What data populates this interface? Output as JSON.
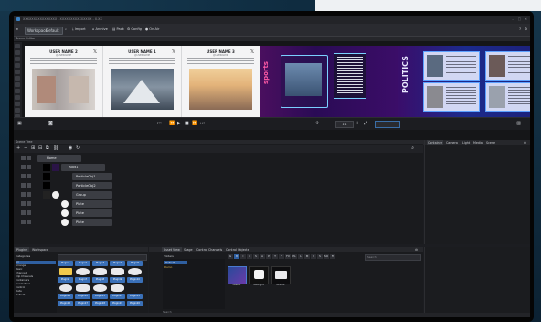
{
  "window": {
    "title": "XXXXXXXXXXXXXXXX - XXXXXXXXXXXXXXX - X.XX"
  },
  "toolbar": {
    "workspace_label": "Workspace",
    "workspace_value": "Default",
    "import_label": "Import",
    "archive_label": "Archive",
    "pack_label": "Pack",
    "config_label": "Config",
    "onair_label": "On Air"
  },
  "scene_editor": {
    "header": "Scene Editor",
    "zoom": "1:1"
  },
  "canvas": {
    "cards": [
      {
        "username": "USER NAME 2",
        "handle": "@USERNAME"
      },
      {
        "username": "USER NAME 1",
        "handle": "@USERNAME"
      },
      {
        "username": "USER NAME 3",
        "handle": "@USERNAME"
      }
    ],
    "sports_label": "sports",
    "politics_label": "POLITICS"
  },
  "scene_tree": {
    "header": "Scene Tree",
    "nodes": [
      {
        "label": "Home",
        "depth": 0
      },
      {
        "label": "Root1",
        "depth": 1
      },
      {
        "label": "ParticleObj1",
        "depth": 2
      },
      {
        "label": "ParticleObj2",
        "depth": 2
      },
      {
        "label": "Group",
        "depth": 2
      },
      {
        "label": "Plate",
        "depth": 2
      },
      {
        "label": "Plate",
        "depth": 2
      },
      {
        "label": "Plate",
        "depth": 2
      }
    ]
  },
  "right_panel": {
    "tabs": [
      "Container",
      "Camera",
      "Light",
      "Media",
      "Scene"
    ]
  },
  "plugins": {
    "tabs": [
      "Plugins",
      "Workspace"
    ],
    "categories_label": "Categories",
    "categories": [
      "All",
      "Arrange",
      "Basic",
      "Channels",
      "Clip Channels",
      "Containers",
      "Geometries",
      "Control",
      "Data",
      "Default"
    ],
    "items": [
      "Plugin1",
      "Plugin2",
      "Plugin3",
      "Plugin4",
      "Plugin5",
      "Plugin6",
      "Plugin7",
      "Plugin8",
      "Plugin9",
      "Plugin10",
      "Plugin11",
      "Plugin12",
      "Plugin13",
      "Plugin14",
      "Plugin15",
      "Plugin16",
      "Plugin17",
      "Plugin18",
      "Plugin19",
      "Plugin20"
    ]
  },
  "assets": {
    "tabs": [
      "Asset View",
      "Stage",
      "Control Channels",
      "Control Objects"
    ],
    "folders_label": "Folders",
    "folders": [
      "Default",
      "Demo"
    ],
    "toggles": [
      "G",
      "M",
      "I",
      "C",
      "S",
      "A",
      "P",
      "T",
      "F",
      "FX",
      "PL",
      "L",
      "M",
      "V",
      "S",
      "SO",
      "Fi"
    ],
    "search_placeholder": "Search",
    "items": [
      {
        "name": "Asset1"
      },
      {
        "name": "TextLight"
      },
      {
        "name": "ALBM0"
      }
    ]
  },
  "colors": {
    "accent": "#3a70b8",
    "panel": "#1a1b1e",
    "toolbar": "#2a2b30"
  },
  "icons": [
    "search-icon",
    "play-icon",
    "pause-icon",
    "stop-icon",
    "skip-forward-icon",
    "skip-back-icon",
    "eye-icon",
    "lock-icon",
    "gear-icon"
  ]
}
